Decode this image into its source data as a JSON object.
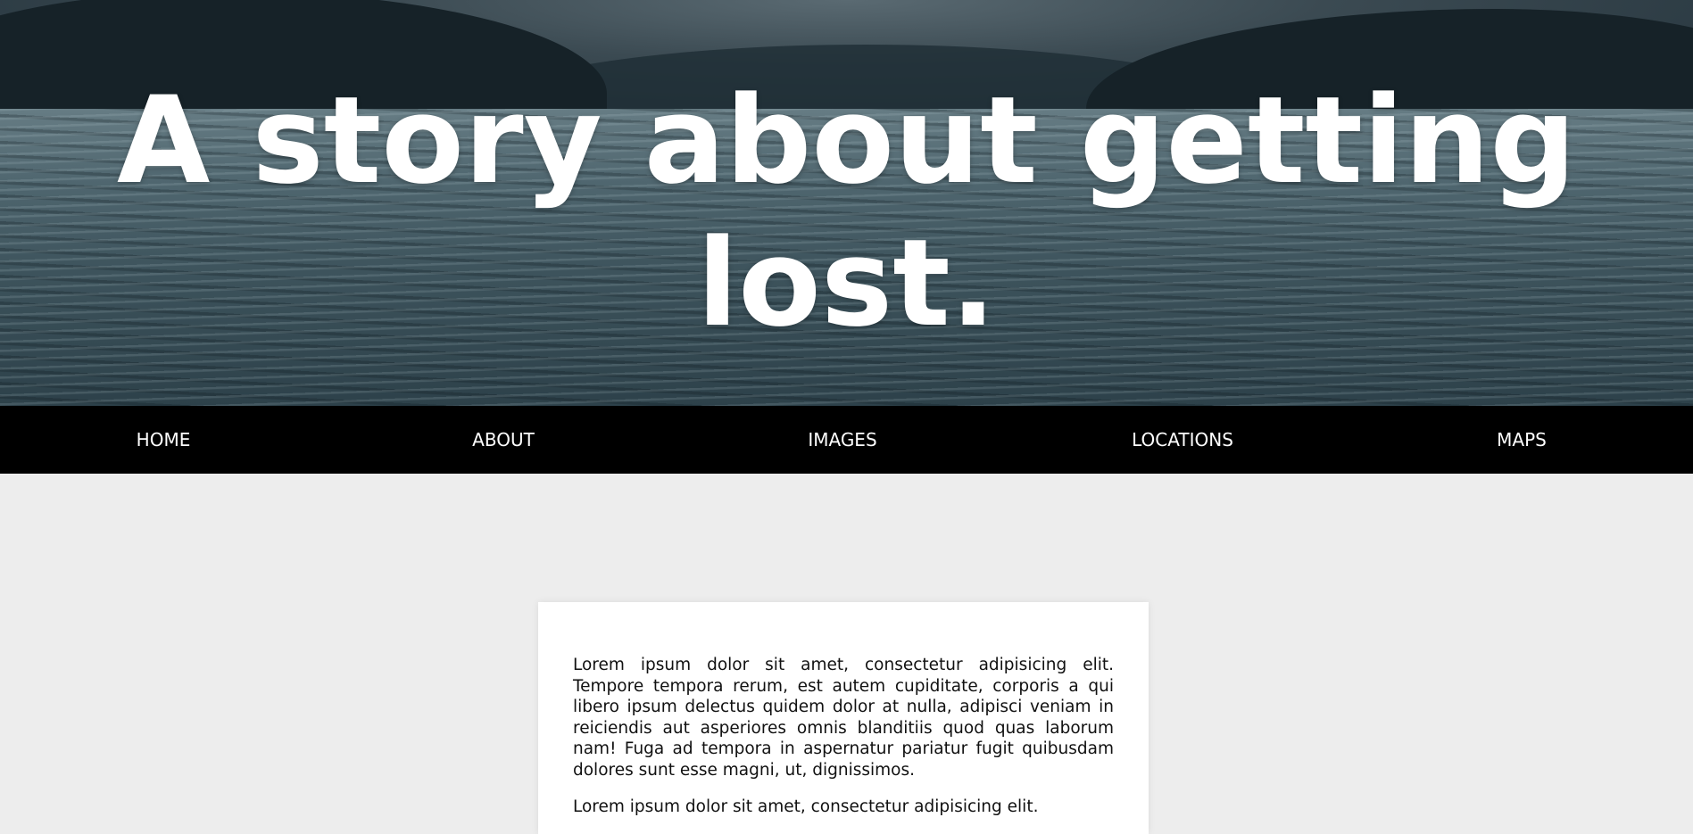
{
  "hero": {
    "title": "A story about getting lost."
  },
  "nav": {
    "items": [
      {
        "label": "HOME"
      },
      {
        "label": "ABOUT"
      },
      {
        "label": "IMAGES"
      },
      {
        "label": "LOCATIONS"
      },
      {
        "label": "MAPS"
      }
    ]
  },
  "content": {
    "paragraphs": [
      "Lorem ipsum dolor sit amet, consectetur adipisicing elit. Tempore tempora rerum, est autem cupiditate, corporis a qui libero ipsum delectus quidem dolor at nulla, adipisci veniam in reiciendis aut asperiores omnis blanditiis quod quas laborum nam! Fuga ad tempora in aspernatur pariatur fugit quibusdam dolores sunt esse magni, ut, dignissimos.",
      "Lorem ipsum dolor sit amet, consectetur adipisicing elit."
    ]
  },
  "colors": {
    "page_background": "#ededed",
    "nav_background": "#000000",
    "nav_text": "#ffffff",
    "card_background": "#ffffff",
    "title_text": "#ffffff"
  }
}
